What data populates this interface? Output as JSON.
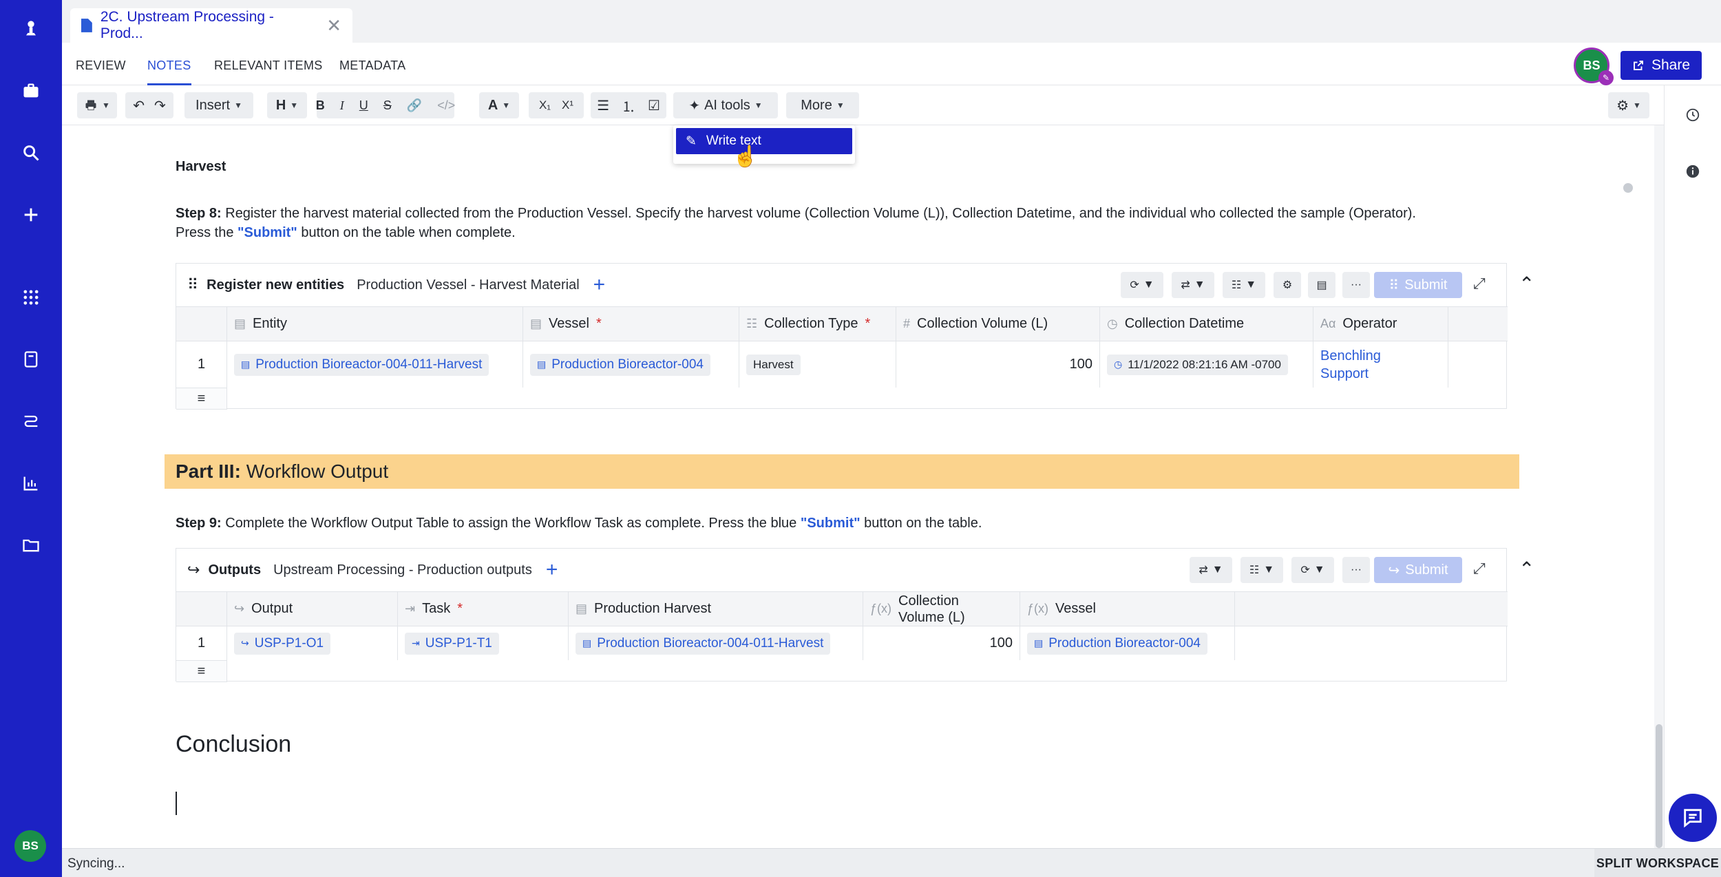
{
  "tab": {
    "title": "2C. Upstream Processing - Prod...",
    "close": "✕"
  },
  "subnav": {
    "review": "REVIEW",
    "notes": "NOTES",
    "relevant": "RELEVANT ITEMS",
    "metadata": "METADATA",
    "avatar_initials": "BS",
    "share": "Share"
  },
  "toolbar": {
    "insert": "Insert",
    "heading": "H",
    "bold": "B",
    "italic": "I",
    "underline": "U",
    "strike": "S",
    "text_color": "A",
    "subscript": "X₁",
    "superscript": "X¹",
    "ai_tools": "AI tools",
    "more": "More"
  },
  "ai_menu": {
    "write_text": "Write text"
  },
  "content": {
    "harvest_heading": "Harvest",
    "step8_label": "Step 8:",
    "step8_text": " Register the harvest material collected from the Production Vessel. Specify the harvest volume (Collection Volume (L)), Collection Datetime, and the individual who collected the sample (Operator).",
    "step8_press": "Press the ",
    "step8_submit": "\"Submit\"",
    "step8_tail": " button on the table when complete.",
    "part3_label": "Part III:",
    "part3_title": " Workflow Output",
    "step9_label": "Step 9:",
    "step9_text": " Complete the Workflow Output Table to assign the Workflow Task as complete. Press the blue ",
    "step9_submit": "\"Submit\"",
    "step9_tail": " button on the table.",
    "conclusion": "Conclusion"
  },
  "table1": {
    "title": "Register new entities",
    "subtitle": "Production Vessel - Harvest Material",
    "submit": "Submit",
    "headers": {
      "entity": "Entity",
      "vessel": "Vessel",
      "collection_type": "Collection Type",
      "collection_volume": "Collection Volume (L)",
      "collection_datetime": "Collection Datetime",
      "operator": "Operator"
    },
    "row": {
      "num": "1",
      "entity": "Production Bioreactor-004-011-Harvest",
      "vessel": "Production Bioreactor-004",
      "collection_type": "Harvest",
      "collection_volume": "100",
      "collection_datetime": "11/1/2022 08:21:16 AM -0700",
      "operator_line1": "Benchling",
      "operator_line2": "Support"
    }
  },
  "table2": {
    "title": "Outputs",
    "subtitle": "Upstream Processing - Production outputs",
    "submit": "Submit",
    "headers": {
      "output": "Output",
      "task": "Task",
      "production_harvest": "Production Harvest",
      "collection_volume_1": "Collection",
      "collection_volume_2": "Volume (L)",
      "vessel": "Vessel"
    },
    "row": {
      "num": "1",
      "output": "USP-P1-O1",
      "task": "USP-P1-T1",
      "production_harvest": "Production Bioreactor-004-011-Harvest",
      "collection_volume": "100",
      "vessel": "Production Bioreactor-004"
    }
  },
  "status": {
    "sync": "Syncing...",
    "split": "SPLIT WORKSPACE"
  },
  "colors": {
    "brand": "#1c22c4",
    "accent": "#2a5bd7",
    "section": "#fbd38d",
    "avatar": "#1a8f4a"
  }
}
